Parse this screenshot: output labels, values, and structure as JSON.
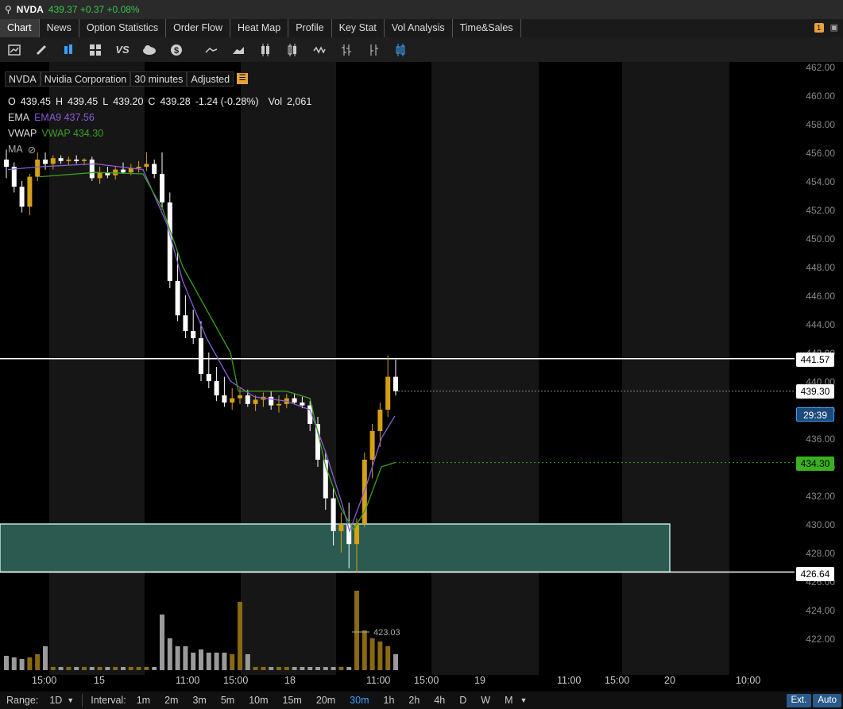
{
  "topbar": {
    "symbol": "NVDA",
    "quote": "439.37 +0.37 +0.08%"
  },
  "tabs": [
    {
      "label": "Chart",
      "active": true
    },
    {
      "label": "News"
    },
    {
      "label": "Option Statistics"
    },
    {
      "label": "Order Flow"
    },
    {
      "label": "Heat Map"
    },
    {
      "label": "Profile"
    },
    {
      "label": "Key Stat"
    },
    {
      "label": "Vol Analysis"
    },
    {
      "label": "Time&Sales"
    }
  ],
  "tabs_badge": "1",
  "toolbar_icons": [
    "chart-settings-icon",
    "draw-icon",
    "candle-style-icon",
    "grid-layout-icon",
    "compare-icon",
    "cloud-icon",
    "dollar-icon",
    "line-chart-icon",
    "area-chart-icon",
    "bar-chart-icon",
    "candlestick-icon",
    "wave-icon",
    "ohlc-icon",
    "hlc-icon",
    "hollow-candle-icon"
  ],
  "info": {
    "symbol": "NVDA",
    "name": "Nvidia Corporation",
    "interval": "30 minutes",
    "adjust": "Adjusted"
  },
  "ohlc": {
    "o_label": "O",
    "o": "439.45",
    "h_label": "H",
    "h": "439.45",
    "l_label": "L",
    "l": "439.20",
    "c_label": "C",
    "c": "439.28",
    "chg": "-1.24 (-0.28%)",
    "vol_label": "Vol",
    "vol": "2,061"
  },
  "indicators": {
    "ema_label": "EMA",
    "ema_value": "EMA9 437.56",
    "vwap_label": "VWAP",
    "vwap_value": "VWAP 434.30",
    "ma_label": "MA"
  },
  "price_axis": [
    "462.00",
    "460.00",
    "458.00",
    "456.00",
    "454.00",
    "452.00",
    "450.00",
    "448.00",
    "446.00",
    "444.00",
    "442.00",
    "440.00",
    "438.00",
    "436.00",
    "434.00",
    "432.00",
    "430.00",
    "428.00",
    "426.00",
    "424.00",
    "422.00"
  ],
  "tags": {
    "resistance": "441.57",
    "last": "439.30",
    "countdown": "29:39",
    "vwap": "434.30",
    "support": "426.64",
    "low_marker": "423.03"
  },
  "time_axis": [
    "15:00",
    "15",
    "11:00",
    "15:00",
    "18",
    "11:00",
    "15:00",
    "19",
    "11:00",
    "15:00",
    "20",
    "10:00"
  ],
  "bottom": {
    "range_label": "Range:",
    "range_value": "1D",
    "interval_label": "Interval:",
    "intervals": [
      "1m",
      "2m",
      "3m",
      "5m",
      "10m",
      "15m",
      "20m",
      "30m",
      "1h",
      "2h",
      "4h",
      "D",
      "W",
      "M"
    ],
    "active_interval": "30m",
    "ext": "Ext.",
    "auto": "Auto"
  },
  "colors": {
    "up": "#d4a017",
    "down": "#ffffff",
    "ema": "#8a5cd6",
    "vwap": "#3aa020",
    "zone": "#2a5a50",
    "zone_border": "#b8e8e0",
    "countdown_bg": "#1d4a7a",
    "vwap_tag": "#3ab020"
  }
}
